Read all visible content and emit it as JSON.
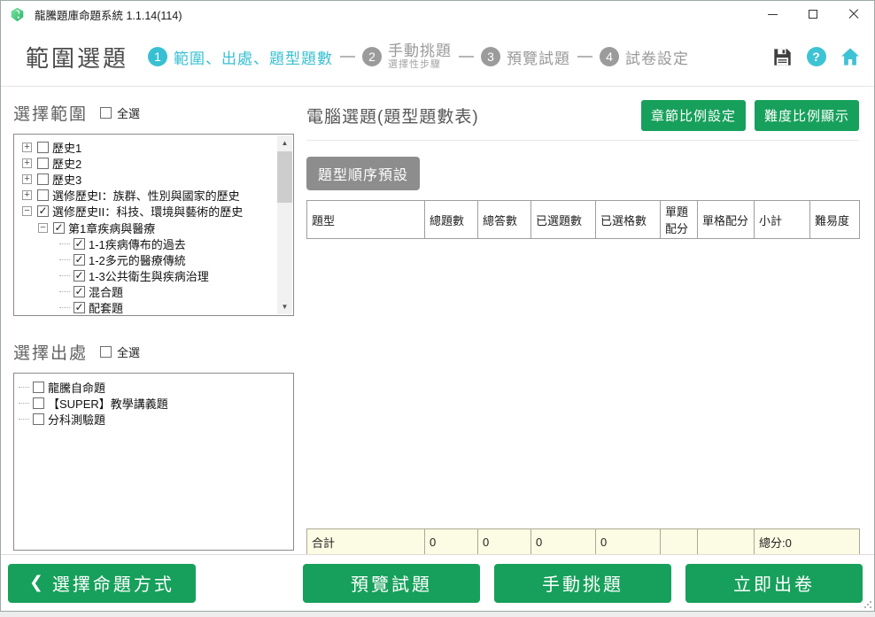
{
  "window": {
    "title": "龍騰題庫命題系統 1.1.14(114)"
  },
  "header": {
    "page_title": "範圍選題",
    "help_glyph": "?",
    "steps": [
      {
        "num": "1",
        "label": "範圍、出處、題型題數",
        "active": true
      },
      {
        "num": "2",
        "label": "手動挑題",
        "sub": "選擇性步驟",
        "active": false
      },
      {
        "num": "3",
        "label": "預覽試題",
        "active": false
      },
      {
        "num": "4",
        "label": "試卷設定",
        "active": false
      }
    ]
  },
  "left": {
    "range_title": "選擇範圍",
    "range_select_all": "全選",
    "tree": [
      {
        "exp": "+",
        "level": 0,
        "checked": false,
        "label": "歷史1"
      },
      {
        "exp": "+",
        "level": 0,
        "checked": false,
        "label": "歷史2"
      },
      {
        "exp": "+",
        "level": 0,
        "checked": false,
        "label": "歷史3"
      },
      {
        "exp": "+",
        "level": 0,
        "checked": false,
        "label": "選修歷史I：族群、性別與國家的歷史"
      },
      {
        "exp": "−",
        "level": 0,
        "checked": true,
        "label": "選修歷史II：科技、環境與藝術的歷史"
      },
      {
        "exp": "−",
        "level": 1,
        "checked": true,
        "label": "第1章疾病與醫療"
      },
      {
        "exp": "",
        "level": 2,
        "checked": true,
        "label": "1-1疾病傳布的過去"
      },
      {
        "exp": "",
        "level": 2,
        "checked": true,
        "label": "1-2多元的醫療傳統"
      },
      {
        "exp": "",
        "level": 2,
        "checked": true,
        "label": "1-3公共衛生與疾病治理"
      },
      {
        "exp": "",
        "level": 2,
        "checked": true,
        "label": "混合題"
      },
      {
        "exp": "",
        "level": 2,
        "checked": true,
        "label": "配套題"
      }
    ],
    "source_title": "選擇出處",
    "source_select_all": "全選",
    "sources": [
      {
        "checked": false,
        "label": "龍騰自命題"
      },
      {
        "checked": false,
        "label": "【SUPER】教學講義題"
      },
      {
        "checked": false,
        "label": "分科測驗題"
      }
    ]
  },
  "main": {
    "title": "電腦選題(題型題數表)",
    "chapter_ratio_btn": "章節比例設定",
    "difficulty_ratio_btn": "難度比例顯示",
    "type_order_btn": "題型順序預設",
    "table": {
      "headers": [
        "題型",
        "總題數",
        "總答數",
        "已選題數",
        "已選格數",
        "單題配分",
        "單格配分",
        "小計",
        "難易度"
      ],
      "footer": {
        "label": "合計",
        "c1": "0",
        "c2": "0",
        "c3": "0",
        "c4": "0",
        "total": "總分:0"
      }
    }
  },
  "footer_buttons": {
    "back": "選擇命題方式",
    "back_chevron": "❮",
    "preview": "預覽試題",
    "manual": "手動挑題",
    "generate": "立即出卷"
  },
  "colors": {
    "green": "#17a05b",
    "teal": "#38c0d2",
    "step_gray": "#9b9b9b",
    "footer_row_bg": "#fcfbe3"
  }
}
